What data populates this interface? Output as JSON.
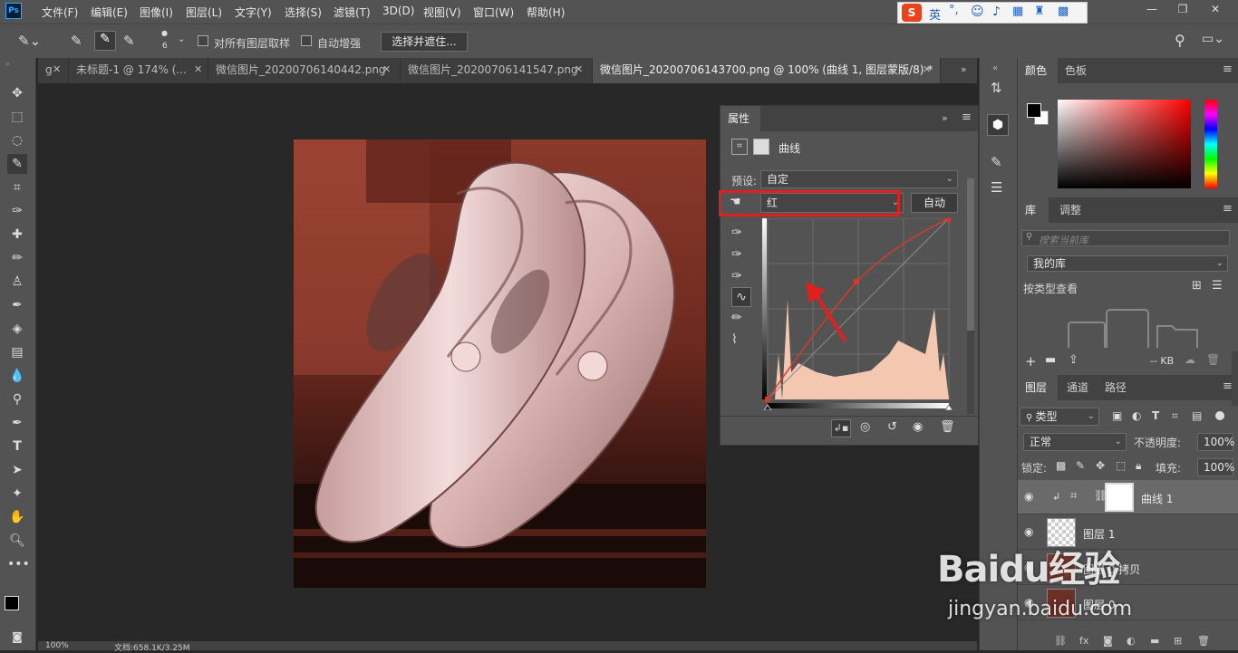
{
  "app": {
    "logo": "Ps"
  },
  "menu": [
    "文件(F)",
    "编辑(E)",
    "图像(I)",
    "图层(L)",
    "文字(Y)",
    "选择(S)",
    "滤镜(T)",
    "3D(D)",
    "视图(V)",
    "窗口(W)",
    "帮助(H)"
  ],
  "ime": {
    "mode": "英"
  },
  "options": {
    "brush_size": "6",
    "sample_all_layers": "对所有图层取样",
    "auto_enhance": "自动增强",
    "select_mask_button": "选择并遮住..."
  },
  "tabs": [
    {
      "label": "g",
      "active": false
    },
    {
      "label": "未标题-1 @ 174% (...",
      "active": false
    },
    {
      "label": "微信图片_20200706140442.png",
      "active": false
    },
    {
      "label": "微信图片_20200706141547.png",
      "active": false
    },
    {
      "label": "微信图片_20200706143700.png @ 100% (曲线 1, 图层蒙版/8) *",
      "active": true
    }
  ],
  "properties": {
    "tab": "属性",
    "title": "曲线",
    "preset_label": "预设:",
    "preset_value": "自定",
    "channel_value": "红",
    "auto_button": "自动"
  },
  "color_panel": {
    "tabs": [
      "颜色",
      "色板"
    ],
    "accent": "#ff0000"
  },
  "library": {
    "tabs": [
      "库",
      "调整"
    ],
    "search_placeholder": "搜索当前库",
    "library_name": "我的库",
    "view_by": "按类型查看",
    "size": "-- KB"
  },
  "layers_panel": {
    "tabs": [
      "图层",
      "通道",
      "路径"
    ],
    "kind": "类型",
    "blend_mode": "正常",
    "opacity_label": "不透明度:",
    "opacity": "100%",
    "lock_label": "锁定:",
    "fill_label": "填充:",
    "fill": "100%",
    "layers": [
      {
        "name": "曲线 1",
        "selected": true
      },
      {
        "name": "图层 1",
        "selected": false
      },
      {
        "name": "图层 0 拷贝",
        "selected": false
      },
      {
        "name": "图层 0",
        "selected": false
      }
    ]
  },
  "status": {
    "zoom": "100%",
    "doc_size": "文档:658.1K/3.25M"
  },
  "watermark": {
    "brand": "Baidu经验",
    "url": "jingyan.baidu.com"
  },
  "annotation_color": "#e02020"
}
